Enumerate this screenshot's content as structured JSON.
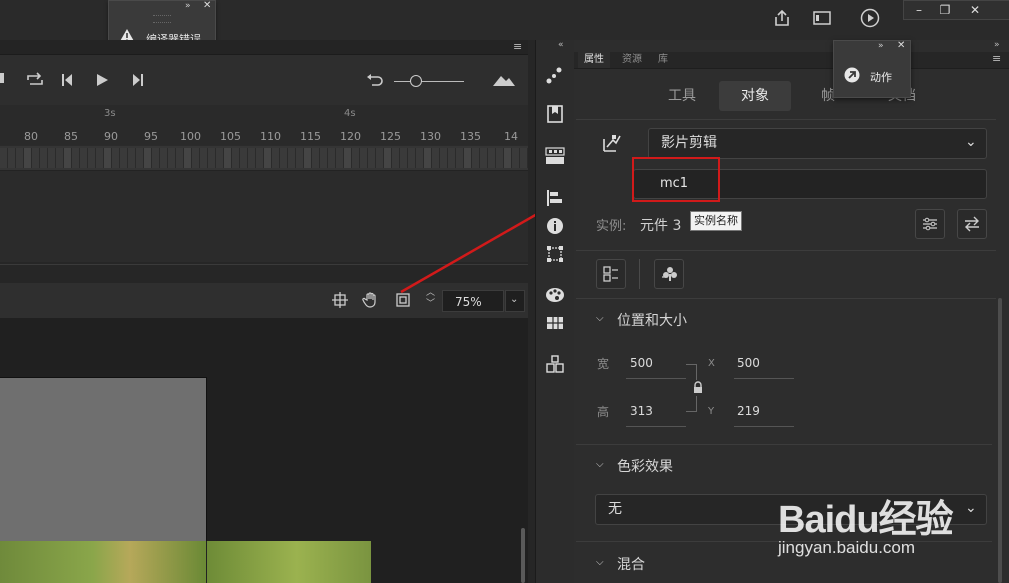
{
  "compiler_errors_panel": {
    "title": "编译器错误"
  },
  "actions_panel": {
    "title": "动作"
  },
  "timeline": {
    "seconds": [
      "3s",
      "4s"
    ],
    "frame_numbers": [
      "80",
      "85",
      "90",
      "95",
      "100",
      "105",
      "110",
      "115",
      "120",
      "125",
      "130",
      "135",
      "14"
    ]
  },
  "stage_toolbar": {
    "zoom": "75%"
  },
  "panel_tabs": [
    "属性",
    "资源",
    "库"
  ],
  "properties": {
    "segments": [
      "工具",
      "对象",
      "帧",
      "文档"
    ],
    "active_segment": "对象",
    "symbol_type": "影片剪辑",
    "instance_name": "mc1",
    "instance_label": "实例:",
    "instance_of": "元件 3",
    "tooltip": "实例名称",
    "position_size": {
      "title": "位置和大小",
      "width_label": "宽",
      "width": "500",
      "height_label": "高",
      "height": "313",
      "x_label": "X",
      "x": "500",
      "y_label": "Y",
      "y": "219"
    },
    "color_effect": {
      "title": "色彩效果",
      "value": "无"
    },
    "blend": {
      "title": "混合"
    }
  },
  "watermark": {
    "brand": "Baidu经验",
    "url": "jingyan.baidu.com"
  },
  "colors": {
    "highlight_red": "#d11a1a",
    "panel_bg": "#2d2d2d",
    "app_bg": "#262626"
  }
}
